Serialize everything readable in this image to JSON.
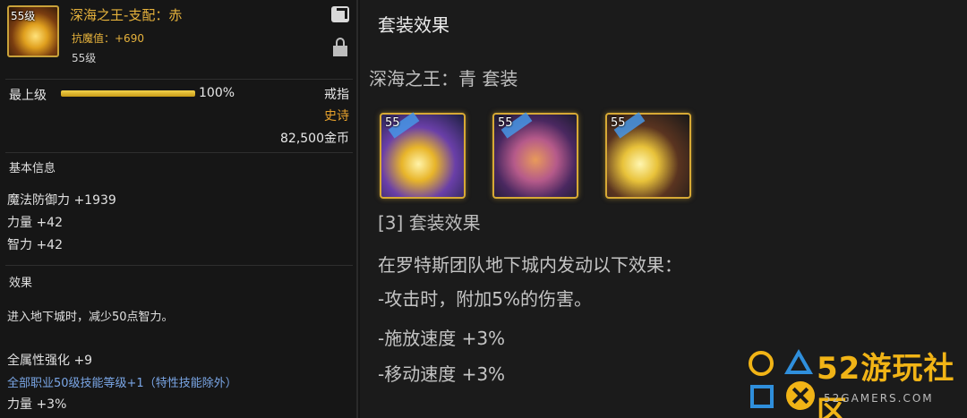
{
  "item": {
    "icon_level": "55级",
    "name": "深海之王-支配：赤",
    "resist": "抗魔值：+690",
    "level": "55级",
    "grade_label": "最上级",
    "grade_percent_text": "100%",
    "grade_fill": 1.0,
    "slot": "戒指",
    "rarity": "史诗",
    "price": "82,500金币",
    "share_icon": "share-icon",
    "lock_icon": "lock-icon",
    "basic_info_title": "基本信息",
    "stats": [
      "魔法防御力 +1939",
      "力量 +42",
      "智力 +42"
    ],
    "effect_title": "效果",
    "effect_text": "进入地下城时，减少50点智力。",
    "bonus_all": "全属性强化 +9",
    "bonus_skill": "全部职业50级技能等级+1（特性技能除外）",
    "bonus_str": "力量 +3%"
  },
  "set": {
    "header": "套装效果",
    "name": "深海之王：青  套装",
    "icons": [
      {
        "level": "55",
        "icon": "staff-icon"
      },
      {
        "level": "55",
        "icon": "ring-icon"
      },
      {
        "level": "55",
        "icon": "amulet-icon"
      }
    ],
    "count_title": "[3] 套装效果",
    "lines": [
      "在罗特斯团队地下城内发动以下效果：",
      "-攻击时，附加5%的伤害。",
      "-施放速度 +3%",
      "-移动速度 +3%"
    ]
  },
  "watermark": {
    "title": "52游玩社区",
    "subtitle": "52GAMERS.COM"
  },
  "colors": {
    "gold": "#e6b23c",
    "epic_orange": "#e6a12c",
    "skill_blue": "#7aa6e6"
  }
}
